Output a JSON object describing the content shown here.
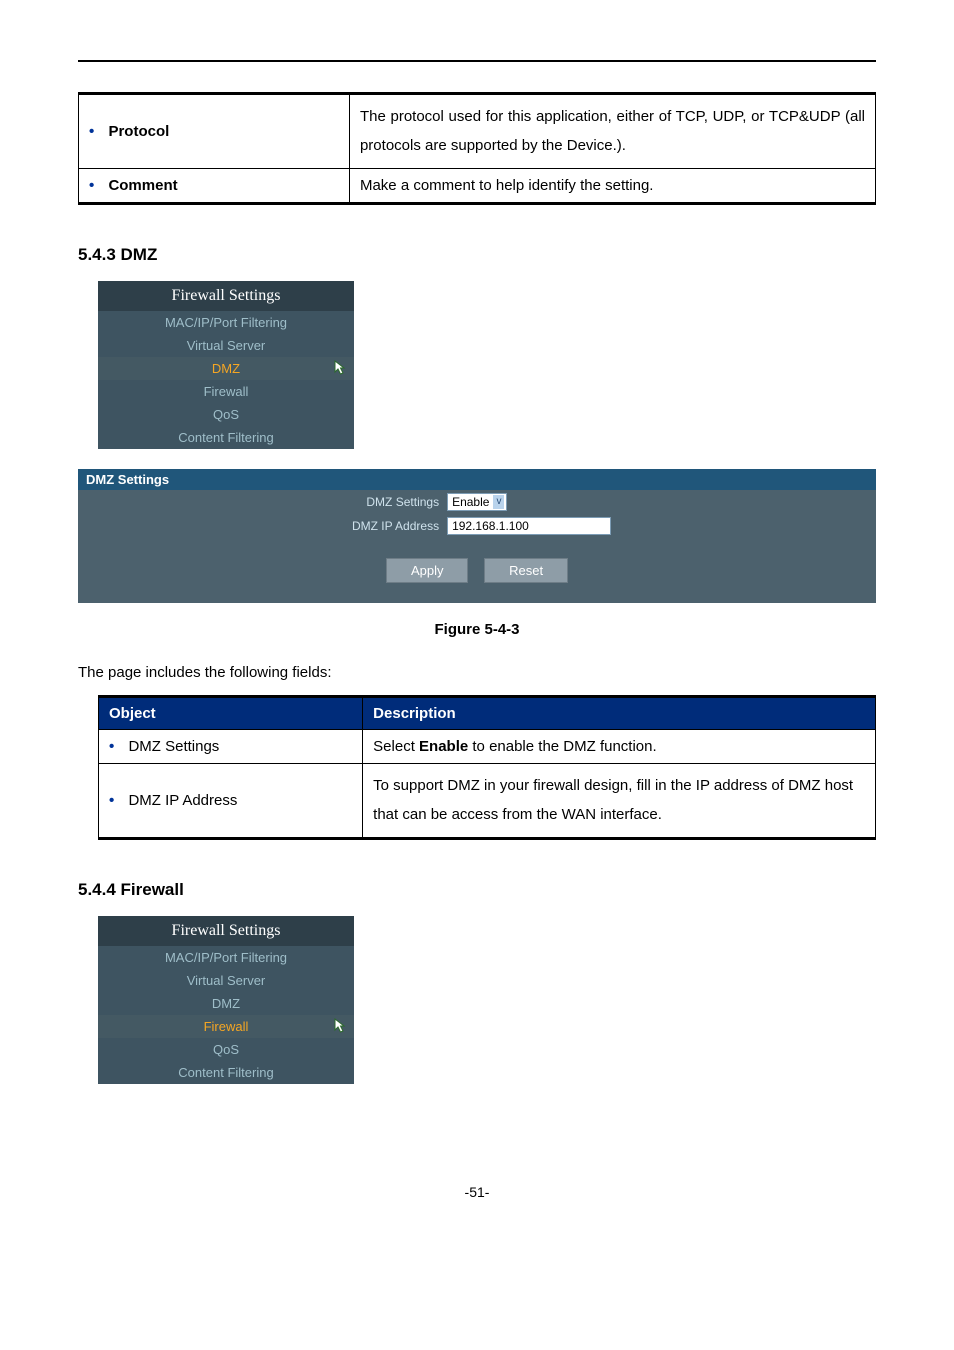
{
  "top_table": {
    "rows": [
      {
        "key": "Protocol",
        "desc": "The protocol used for this application, either of TCP, UDP, or TCP&UDP (all protocols are supported by the Device.)."
      },
      {
        "key": "Comment",
        "desc": "Make a comment to help identify the setting."
      }
    ]
  },
  "section_dmz": {
    "heading": "5.4.3  DMZ"
  },
  "menu1": {
    "header": "Firewall Settings",
    "items": [
      "MAC/IP/Port Filtering",
      "Virtual Server",
      "DMZ",
      "Firewall",
      "QoS",
      "Content Filtering"
    ],
    "selected_index": 2
  },
  "dmz_panel": {
    "title": "DMZ Settings",
    "label_settings": "DMZ Settings",
    "select_value": "Enable",
    "label_ip": "DMZ IP Address",
    "ip_value": "192.168.1.100",
    "apply": "Apply",
    "reset": "Reset"
  },
  "figure_1": "Figure 5-4-3",
  "fields_intro": "The page includes the following fields:",
  "od_table": {
    "header_object": "Object",
    "header_desc": "Description",
    "rows": [
      {
        "key": "DMZ Settings",
        "desc": "Select <b>Enable</b> to enable the DMZ function."
      },
      {
        "key": "DMZ IP Address",
        "desc": "To support DMZ in your firewall design, fill in the IP address of DMZ host that can be access from the WAN interface."
      }
    ]
  },
  "section_firewall": {
    "heading": "5.4.4  Firewall"
  },
  "menu2": {
    "header": "Firewall Settings",
    "items": [
      "MAC/IP/Port Filtering",
      "Virtual Server",
      "DMZ",
      "Firewall",
      "QoS",
      "Content Filtering"
    ],
    "selected_index": 3
  },
  "page_number": "-51-"
}
